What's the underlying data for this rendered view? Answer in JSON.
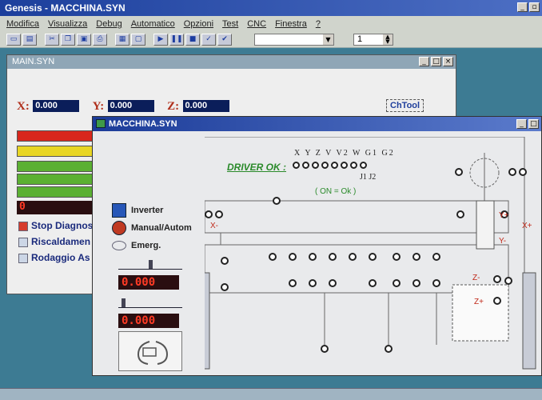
{
  "app": {
    "title": "Genesis - MACCHINA.SYN"
  },
  "menu": [
    "Modifica",
    "Visualizza",
    "Debug",
    "Automatico",
    "Opzioni",
    "Test",
    "CNC",
    "Finestra",
    "?"
  ],
  "toolbar": {
    "combo_value": "",
    "spin_value": "1"
  },
  "main_window": {
    "title": "MAIN.SYN",
    "x_label": "X:",
    "x_value": "0.000",
    "y_label": "Y:",
    "y_value": "0.000",
    "z_label": "Z:",
    "z_value": "0.000",
    "chtool": "ChTool",
    "bars": [
      "#d8271d",
      "#e8d624",
      "#5bb033",
      "#5bb033",
      "#5bb033"
    ],
    "bar_number": "0",
    "checks": [
      "Stop Diagnos",
      "Riscaldamen",
      "Rodaggio As"
    ]
  },
  "machine_window": {
    "title": "MACCHINA.SYN",
    "inverter": "Inverter",
    "manual": "Manual/Autom",
    "emerg": "Emerg.",
    "value1": "0.000",
    "value2": "0.000",
    "driver_label": "DRIVER OK :",
    "axes": "X Y Z V V2 W G1 G2",
    "axes_row2": "J1 J2",
    "on_ok": "( ON = Ok )",
    "x_minus": "X-",
    "x_plus": "X+",
    "y_plus": "Y+",
    "y_minus": "Y-",
    "z_minus": "Z-",
    "z_plus": "Z+"
  },
  "colors": {
    "title_blue": "#1c3f9c",
    "workspace": "#3d7b93",
    "display_red": "#ff3b25"
  }
}
